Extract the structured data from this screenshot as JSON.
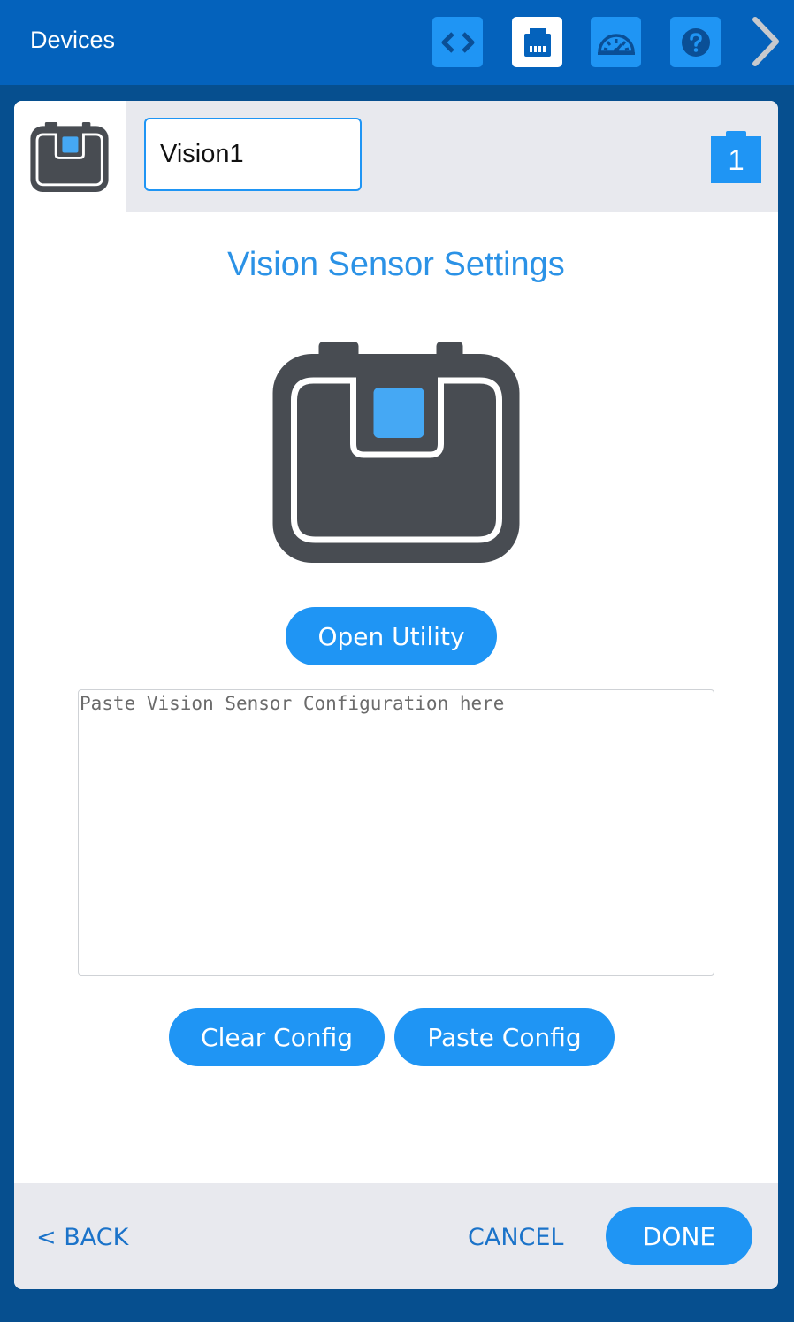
{
  "header": {
    "title": "Devices",
    "buttons": [
      {
        "icon": "code-icon",
        "active": false
      },
      {
        "icon": "devices-icon",
        "active": true
      },
      {
        "icon": "dashboard-icon",
        "active": false
      },
      {
        "icon": "help-icon",
        "active": false
      }
    ],
    "next_icon": "chevron-right-icon"
  },
  "device": {
    "name": "Vision1",
    "port": "1"
  },
  "main": {
    "title": "Vision Sensor Settings",
    "open_utility_label": "Open Utility",
    "config_placeholder": "Paste Vision Sensor Configuration here",
    "config_value": "",
    "clear_config_label": "Clear Config",
    "paste_config_label": "Paste Config"
  },
  "footer": {
    "back_label": "< BACK",
    "cancel_label": "CANCEL",
    "done_label": "DONE"
  },
  "colors": {
    "top_bar": "#0462bc",
    "background": "#064f8f",
    "accent": "#1f95f4",
    "title_text": "#2b92e6",
    "link_text": "#1b73c9",
    "sensor_body": "#484c52"
  }
}
